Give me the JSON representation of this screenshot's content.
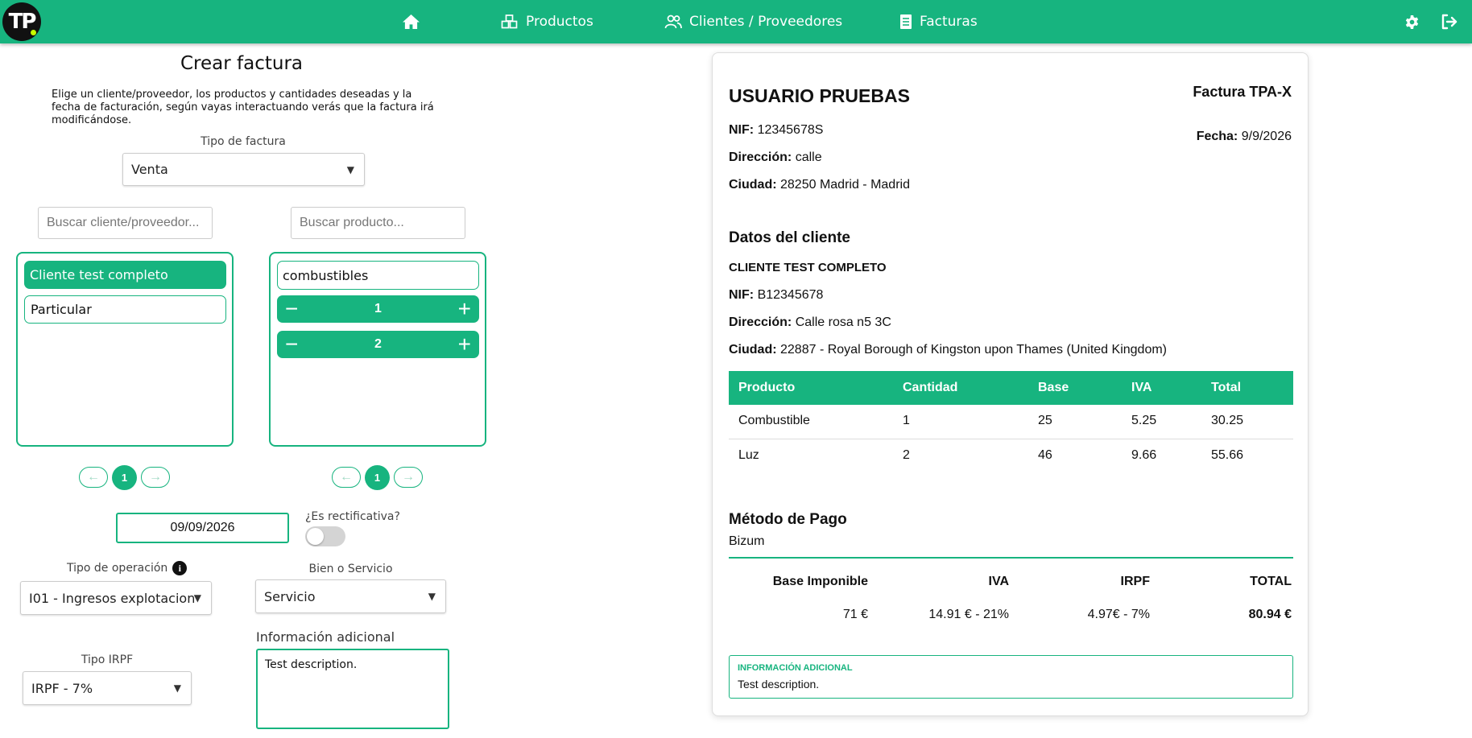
{
  "brand": {
    "logo_text": "TP"
  },
  "nav": {
    "home_icon": "home-icon",
    "items": [
      {
        "label": "Productos",
        "icon": "boxes-icon"
      },
      {
        "label": "Clientes / Proveedores",
        "icon": "users-icon"
      },
      {
        "label": "Facturas",
        "icon": "invoice-icon"
      }
    ],
    "right_icons": [
      "gear-icon",
      "logout-icon"
    ]
  },
  "form": {
    "title": "Crear factura",
    "description": "Elige un cliente/proveedor, los productos y cantidades deseadas y la fecha de facturación, según vayas interactuando verás que la factura irá modificándose.",
    "invoice_type": {
      "label": "Tipo de factura",
      "value": "Venta"
    },
    "client_search": {
      "placeholder": "Buscar cliente/proveedor..."
    },
    "product_search": {
      "placeholder": "Buscar producto..."
    },
    "clients": [
      {
        "label": "Cliente test completo",
        "selected": true
      },
      {
        "label": "Particular",
        "selected": false
      }
    ],
    "products": {
      "filter_value": "combustibles",
      "quantities": [
        {
          "value": "1"
        },
        {
          "value": "2"
        }
      ]
    },
    "client_pager": {
      "prev": "←",
      "page": "1",
      "next": "→"
    },
    "product_pager": {
      "prev": "←",
      "page": "1",
      "next": "→"
    },
    "date": {
      "value": "09/09/2026"
    },
    "rectificativa": {
      "label": "¿Es rectificativa?",
      "checked": false
    },
    "operation_type": {
      "label": "Tipo de operación",
      "value": "I01 - Ingresos explotacion"
    },
    "good_or_service": {
      "label": "Bien o Servicio",
      "value": "Servicio"
    },
    "additional_info": {
      "label": "Información adicional",
      "value": "Test description."
    },
    "irpf_type": {
      "label": "Tipo IRPF",
      "value": "IRPF - 7%"
    },
    "dropdown_arrow": "▼"
  },
  "invoice": {
    "company_name": "USUARIO PRUEBAS",
    "invoice_number": "Factura TPA-X",
    "nif_label": "NIF:",
    "nif": "12345678S",
    "date_label": "Fecha:",
    "date": "9/9/2026",
    "address_label": "Dirección:",
    "address": "calle",
    "city_label": "Ciudad:",
    "city": "28250 Madrid - Madrid",
    "client_section_title": "Datos del cliente",
    "client": {
      "name": "CLIENTE TEST COMPLETO",
      "nif_label": "NIF:",
      "nif": "B12345678",
      "address_label": "Dirección:",
      "address": "Calle rosa n5 3C",
      "city_label": "Ciudad:",
      "city": "22887 - Royal Borough of Kingston upon Thames (United Kingdom)"
    },
    "table": {
      "headers": [
        "Producto",
        "Cantidad",
        "Base",
        "IVA",
        "Total"
      ],
      "rows": [
        [
          "Combustible",
          "1",
          "25",
          "5.25",
          "30.25"
        ],
        [
          "Luz",
          "2",
          "46",
          "9.66",
          "55.66"
        ]
      ]
    },
    "payment": {
      "title": "Método de Pago",
      "method": "Bizum"
    },
    "totals": {
      "headers": [
        "Base Imponible",
        "IVA",
        "IRPF",
        "TOTAL"
      ],
      "values": [
        "71 €",
        "14.91 € - 21%",
        "4.97€ - 7%",
        "80.94 €"
      ]
    },
    "additional_info": {
      "title": "INFORMACIÓN ADICIONAL",
      "text": "Test description."
    }
  },
  "colors": {
    "accent": "#17b47f",
    "navbar": "#17b47f"
  }
}
